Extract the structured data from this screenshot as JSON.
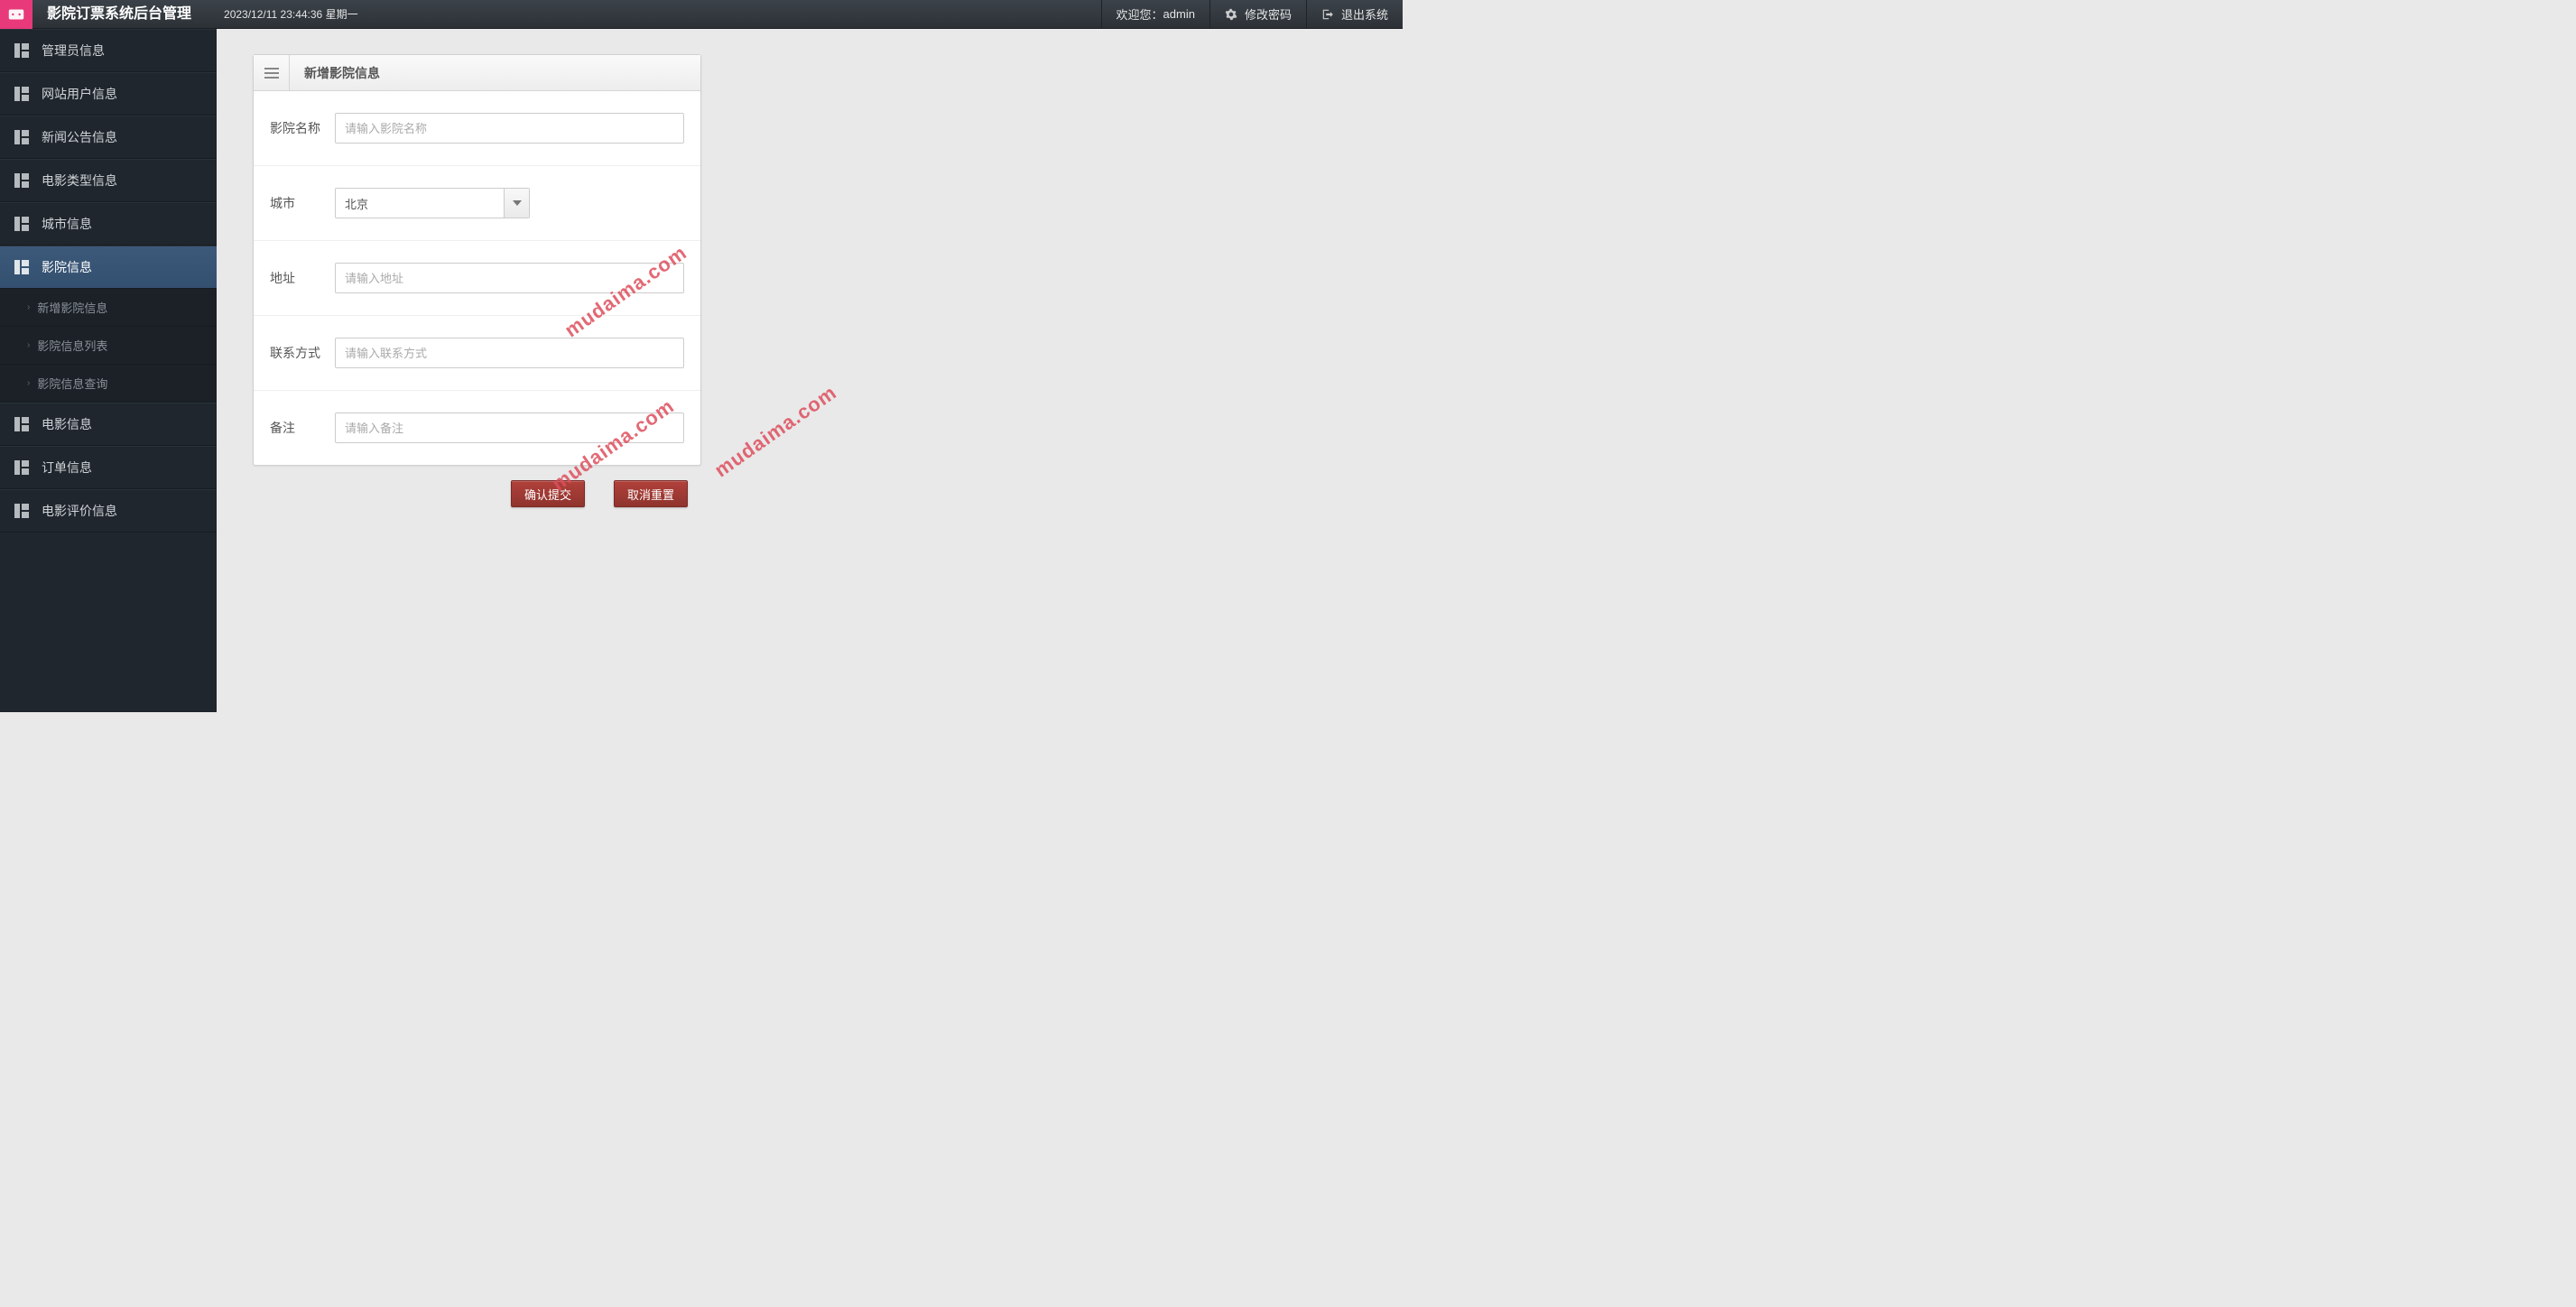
{
  "header": {
    "app_title": "影院订票系统后台管理",
    "datetime": "2023/12/11 23:44:36 星期一",
    "welcome_prefix": "欢迎您：",
    "username": "admin",
    "change_pwd": "修改密码",
    "logout": "退出系统"
  },
  "sidebar": {
    "items": [
      {
        "label": "管理员信息"
      },
      {
        "label": "网站用户信息"
      },
      {
        "label": "新闻公告信息"
      },
      {
        "label": "电影类型信息"
      },
      {
        "label": "城市信息"
      },
      {
        "label": "影院信息",
        "active": true
      },
      {
        "label": "电影信息"
      },
      {
        "label": "订单信息"
      },
      {
        "label": "电影评价信息"
      }
    ],
    "sub_items": [
      {
        "label": "新增影院信息"
      },
      {
        "label": "影院信息列表"
      },
      {
        "label": "影院信息查询"
      }
    ]
  },
  "panel": {
    "title": "新增影院信息"
  },
  "form": {
    "name_label": "影院名称",
    "name_placeholder": "请输入影院名称",
    "city_label": "城市",
    "city_value": "北京",
    "address_label": "地址",
    "address_placeholder": "请输入地址",
    "contact_label": "联系方式",
    "contact_placeholder": "请输入联系方式",
    "remark_label": "备注",
    "remark_placeholder": "请输入备注",
    "submit_label": "确认提交",
    "reset_label": "取消重置"
  },
  "watermark": "mudaima.com"
}
